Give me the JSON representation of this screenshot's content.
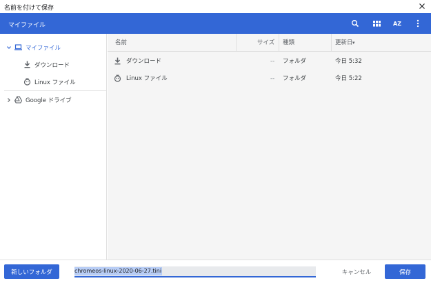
{
  "window": {
    "title": "名前を付けて保存"
  },
  "header": {
    "breadcrumb": "マイファイル",
    "icons": [
      "search-icon",
      "grid-view-icon",
      "sort-az-icon",
      "more-vert-icon"
    ],
    "sort_label": "AZ"
  },
  "sidebar": {
    "items": [
      {
        "label": "マイファイル",
        "icon": "laptop-icon",
        "selected": true
      },
      {
        "label": "ダウンロード",
        "icon": "download-icon"
      },
      {
        "label": "Linux ファイル",
        "icon": "linux-icon"
      },
      {
        "label": "Google ドライブ",
        "icon": "drive-icon"
      }
    ]
  },
  "table": {
    "columns": [
      "名前",
      "サイズ",
      "種類",
      "更新日"
    ],
    "sort_indicator": "▾",
    "rows": [
      {
        "name": "ダウンロード",
        "size": "--",
        "type": "フォルダ",
        "date": "今日 5:32",
        "icon": "download-icon"
      },
      {
        "name": "Linux ファイル",
        "size": "--",
        "type": "フォルダ",
        "date": "今日 5:22",
        "icon": "linux-icon"
      }
    ]
  },
  "footer": {
    "new_folder": "新しいフォルダ",
    "filename": "chromeos-linux-2020-06-27.tini",
    "cancel": "キャンセル",
    "save": "保存"
  },
  "colors": {
    "accent": "#3367d6",
    "content_bg": "#f5f5f5"
  }
}
